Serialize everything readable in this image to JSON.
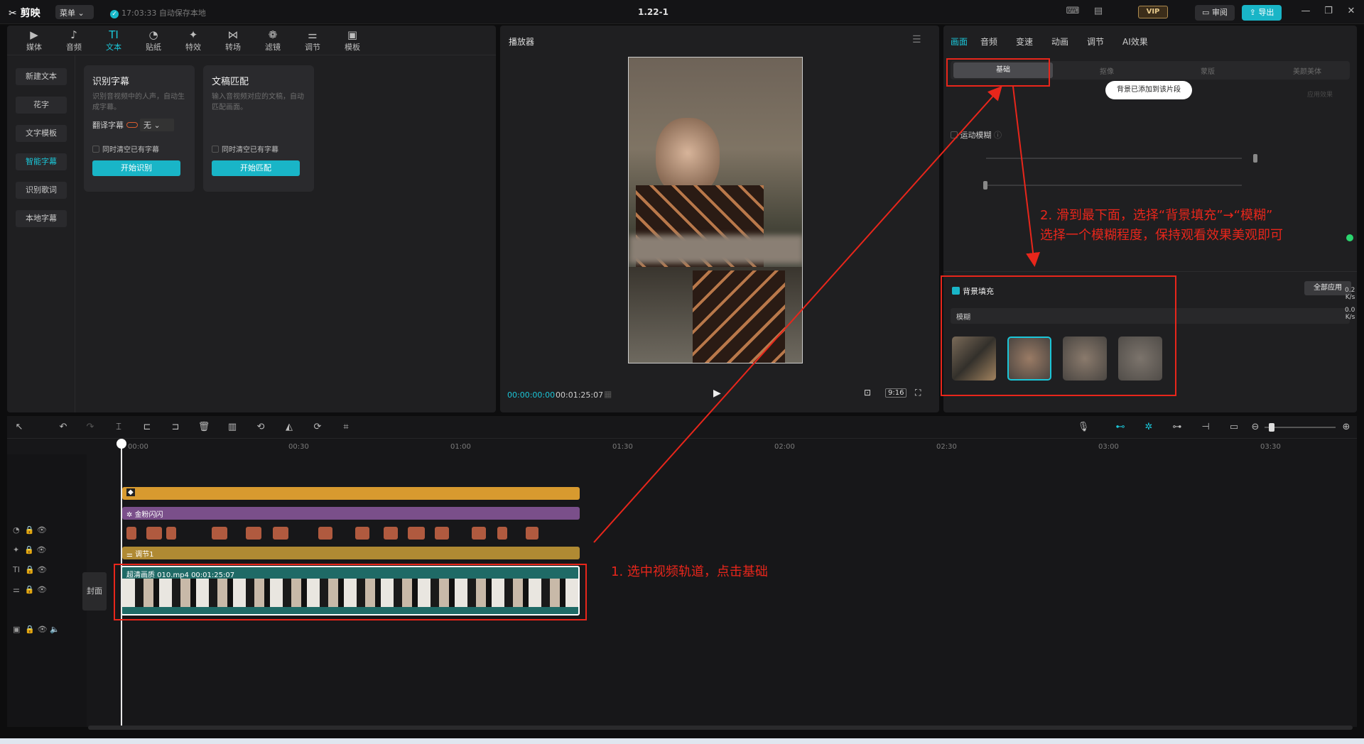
{
  "app": {
    "logo": "剪映",
    "menu": "菜单 ⌄",
    "autosave": "17:03:33 自动保存本地",
    "version": "1.22-1",
    "vip": "VIP",
    "review": "审阅",
    "export": "导出",
    "icons": [
      "keyboard-icon",
      "layout-icon",
      "minimize-icon",
      "maximize-icon",
      "close-icon"
    ]
  },
  "left": {
    "tabs": [
      {
        "label": "媒体",
        "icon": "media-icon"
      },
      {
        "label": "音频",
        "icon": "audio-icon"
      },
      {
        "label": "文本",
        "icon": "text-icon",
        "active": true
      },
      {
        "label": "贴纸",
        "icon": "sticker-icon"
      },
      {
        "label": "特效",
        "icon": "effects-icon"
      },
      {
        "label": "转场",
        "icon": "transition-icon"
      },
      {
        "label": "滤镜",
        "icon": "filter-icon"
      },
      {
        "label": "调节",
        "icon": "adjust-icon"
      },
      {
        "label": "模板",
        "icon": "template-icon"
      }
    ],
    "side": [
      "新建文本",
      "花字",
      "文字模板",
      "智能字幕",
      "识别歌词",
      "本地字幕"
    ],
    "side_active": 3,
    "card1": {
      "title": "识别字幕",
      "desc": "识别音视频中的人声，自动生成字幕。",
      "translate_label": "翻译字幕",
      "translate_value": "无",
      "checkbox": "同时清空已有字幕",
      "button": "开始识别"
    },
    "card2": {
      "title": "文稿匹配",
      "desc": "输入音视频对应的文稿，自动匹配画面。",
      "checkbox": "同时清空已有字幕",
      "button": "开始匹配"
    }
  },
  "player": {
    "title": "播放器",
    "time_current": "00:00:00:00",
    "time_total": "00:01:25:07",
    "ratio": "9:16"
  },
  "right": {
    "tabs": [
      "画面",
      "音频",
      "变速",
      "动画",
      "调节",
      "AI效果"
    ],
    "active_tab": 0,
    "subtabs": [
      "基础",
      "抠像",
      "蒙版",
      "美颜美体"
    ],
    "apply_effect": "应用效果",
    "toast": "背景已添加到该片段",
    "motion_blur": "运动模糊",
    "bg_fill": "背景填充",
    "apply_all": "全部应用",
    "fill_type": "模糊",
    "speed_up": "0.2",
    "speed_up_unit": "K/s",
    "speed_down": "0.0",
    "speed_down_unit": "K/s"
  },
  "annotations": {
    "step1": "1. 选中视频轨道，点击基础",
    "step2_line1": "2. 滑到最下面，选择“背景填充”→“模糊”",
    "step2_line2": "选择一个模糊程度，保持观看效果美观即可",
    "color": "#e8261b"
  },
  "timeline": {
    "ruler": [
      "00:00",
      "00:30",
      "01:00",
      "01:30",
      "02:00",
      "02:30",
      "03:00",
      "03:30"
    ],
    "sticker_clip": "",
    "effect_clip": "金粉闪闪",
    "adjust_clip": "调节1",
    "video_clip": "超清画质  010.mp4  00:01:25:07",
    "cover": "封面"
  },
  "colors": {
    "accent": "#1bc6d8",
    "sticker": "#d89a2f",
    "effect": "#7a4f8a",
    "adjust": "#b08a33",
    "text_clip": "#b05a3f"
  }
}
